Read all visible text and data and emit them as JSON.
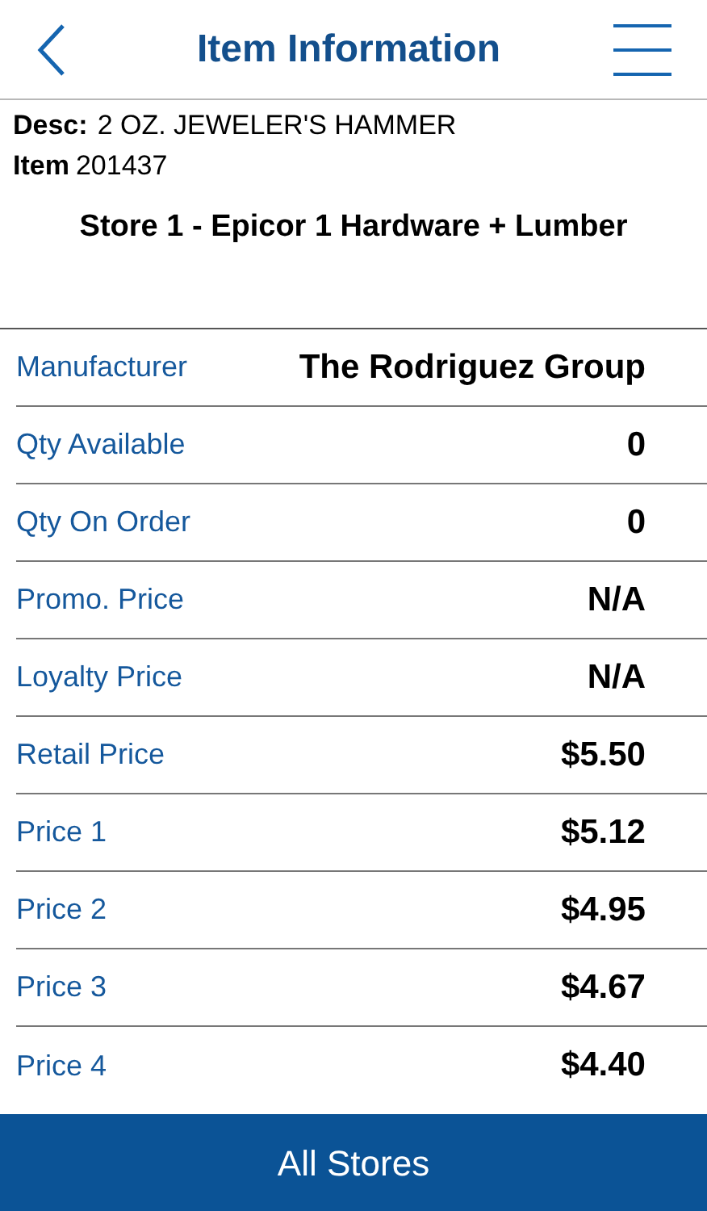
{
  "header": {
    "title": "Item Information"
  },
  "item": {
    "desc_label": "Desc:",
    "desc": "2 OZ. JEWELER'S HAMMER",
    "item_label": "Item",
    "item_number": "201437"
  },
  "store": "Store 1 - Epicor 1 Hardware + Lumber",
  "rows": [
    {
      "label": "Manufacturer",
      "value": "The Rodriguez Group"
    },
    {
      "label": "Qty Available",
      "value": "0"
    },
    {
      "label": "Qty On Order",
      "value": "0"
    },
    {
      "label": "Promo. Price",
      "value": "N/A"
    },
    {
      "label": "Loyalty Price",
      "value": "N/A"
    },
    {
      "label": "Retail Price",
      "value": "$5.50"
    },
    {
      "label": "Price 1",
      "value": "$5.12"
    },
    {
      "label": "Price 2",
      "value": "$4.95"
    },
    {
      "label": "Price 3",
      "value": "$4.67"
    },
    {
      "label": "Price 4",
      "value": "$4.40"
    }
  ],
  "footer_button": "All Stores"
}
